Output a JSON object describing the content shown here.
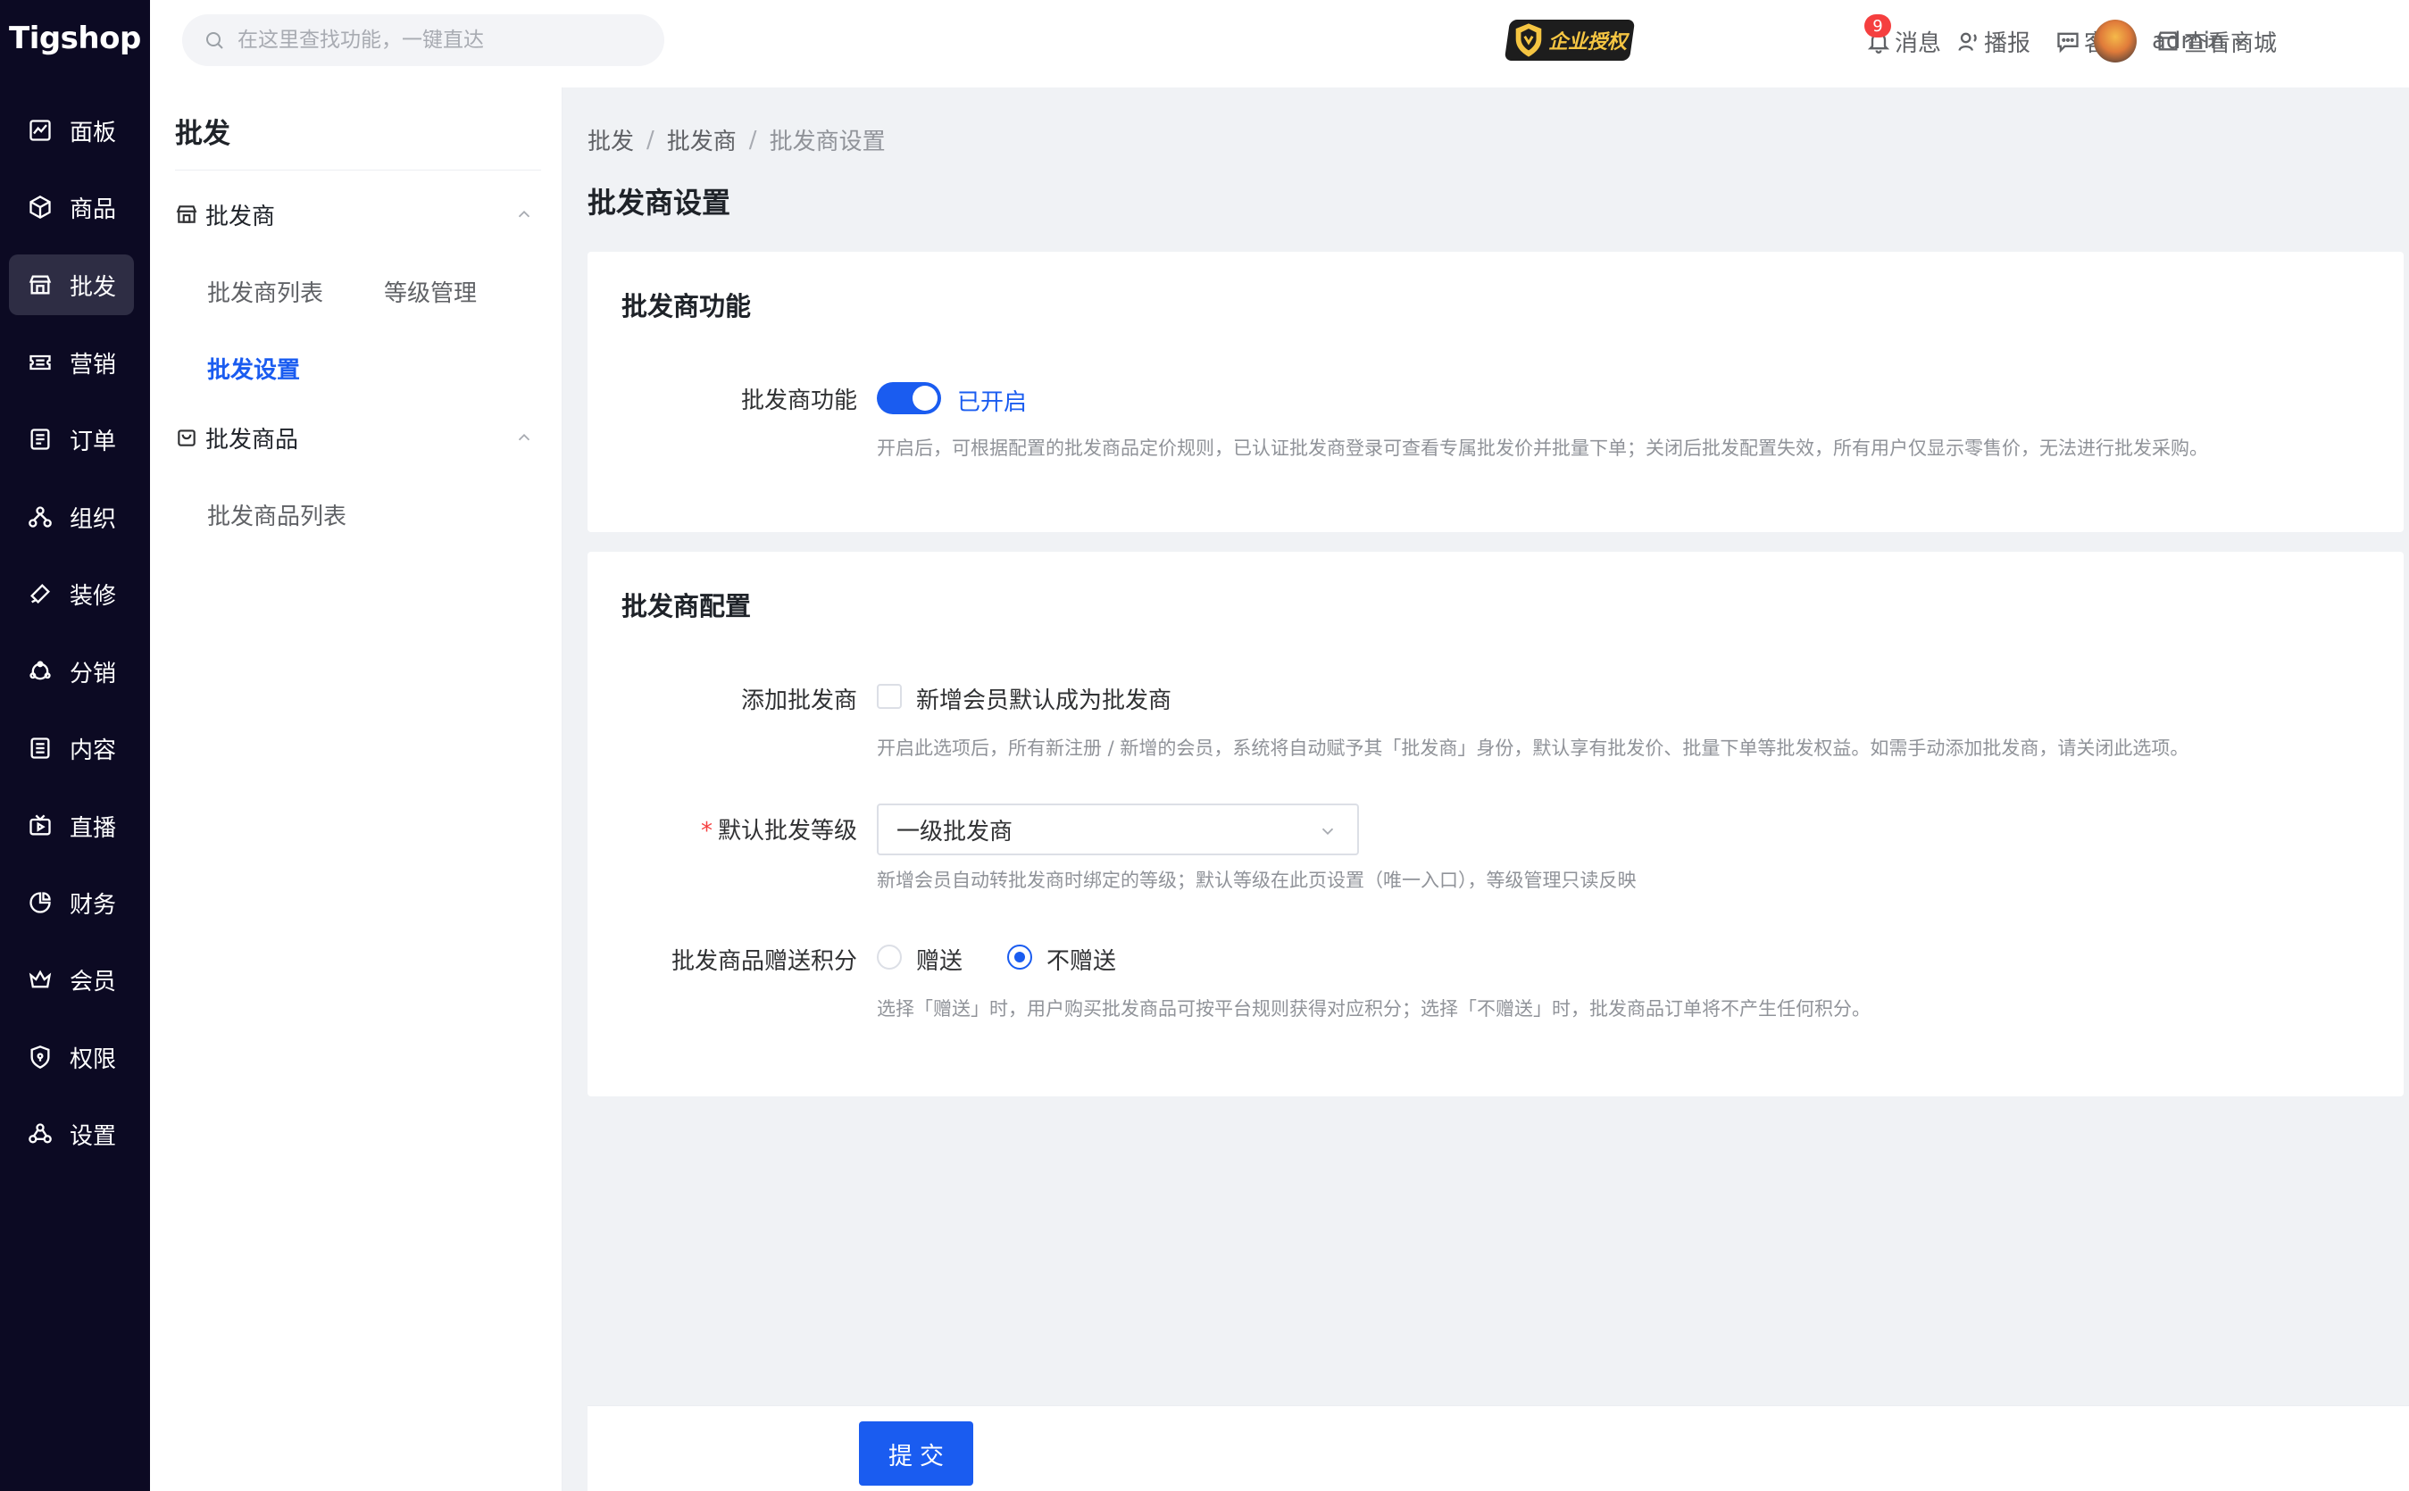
{
  "app": {
    "logo": "Tigshop"
  },
  "leftnav": {
    "items": [
      {
        "label": "面板",
        "icon": "chart-line-icon",
        "active": false
      },
      {
        "label": "商品",
        "icon": "box-icon",
        "active": false
      },
      {
        "label": "批发",
        "icon": "store-icon",
        "active": true
      },
      {
        "label": "营销",
        "icon": "ticket-icon",
        "active": false
      },
      {
        "label": "订单",
        "icon": "order-icon",
        "active": false
      },
      {
        "label": "组织",
        "icon": "org-icon",
        "active": false
      },
      {
        "label": "装修",
        "icon": "brush-icon",
        "active": false
      },
      {
        "label": "分销",
        "icon": "share-icon",
        "active": false
      },
      {
        "label": "内容",
        "icon": "document-icon",
        "active": false
      },
      {
        "label": "直播",
        "icon": "tv-icon",
        "active": false
      },
      {
        "label": "财务",
        "icon": "pie-chart-icon",
        "active": false
      },
      {
        "label": "会员",
        "icon": "crown-icon",
        "active": false
      },
      {
        "label": "权限",
        "icon": "shield-icon",
        "active": false
      },
      {
        "label": "设置",
        "icon": "settings-icon",
        "active": false
      }
    ]
  },
  "topbar": {
    "search_placeholder": "在这里查找功能，一键直达",
    "auth_badge": "企业授权",
    "message_label": "消息",
    "message_count": "9",
    "broadcast_label": "播报",
    "service_label": "客服",
    "shop_label": "查看商城",
    "user_name": "admin"
  },
  "subnav": {
    "title": "批发",
    "groups": [
      {
        "label": "批发商",
        "links": [
          "批发商列表",
          "等级管理",
          "批发设置"
        ]
      },
      {
        "label": "批发商品",
        "links": [
          "批发商品列表"
        ]
      }
    ]
  },
  "breadcrumb": [
    "批发",
    "批发商",
    "批发商设置"
  ],
  "page_title": "批发商设置",
  "card1": {
    "title": "批发商功能",
    "label": "批发商功能",
    "switch_on": true,
    "switch_text": "已开启",
    "hint": "开启后，可根据配置的批发商品定价规则，已认证批发商登录可查看专属批发价并批量下单；关闭后批发配置失效，所有用户仅显示零售价，无法进行批发采购。"
  },
  "card2": {
    "title": "批发商配置",
    "add_label": "添加批发商",
    "add_checkbox": "新增会员默认成为批发商",
    "add_hint": "开启此选项后，所有新注册 / 新增的会员，系统将自动赋予其「批发商」身份，默认享有批发价、批量下单等批发权益。如需手动添加批发商，请关闭此选项。",
    "level_required": "*",
    "level_label": "默认批发等级",
    "level_value": "一级批发商",
    "level_hint": "新增会员自动转批发商时绑定的等级；默认等级在此页设置（唯一入口），等级管理只读反映",
    "points_label": "批发商品赠送积分",
    "points_options": [
      "赠送",
      "不赠送"
    ],
    "points_selected": "不赠送",
    "points_hint": "选择「赠送」时，用户购买批发商品可按平台规则获得对应积分；选择「不赠送」时，批发商品订单将不产生任何积分。"
  },
  "submit_label": "提交",
  "colors": {
    "primary": "#1a5cf0",
    "nav_bg": "#0c0a23",
    "badge_red": "#f53f3f"
  }
}
